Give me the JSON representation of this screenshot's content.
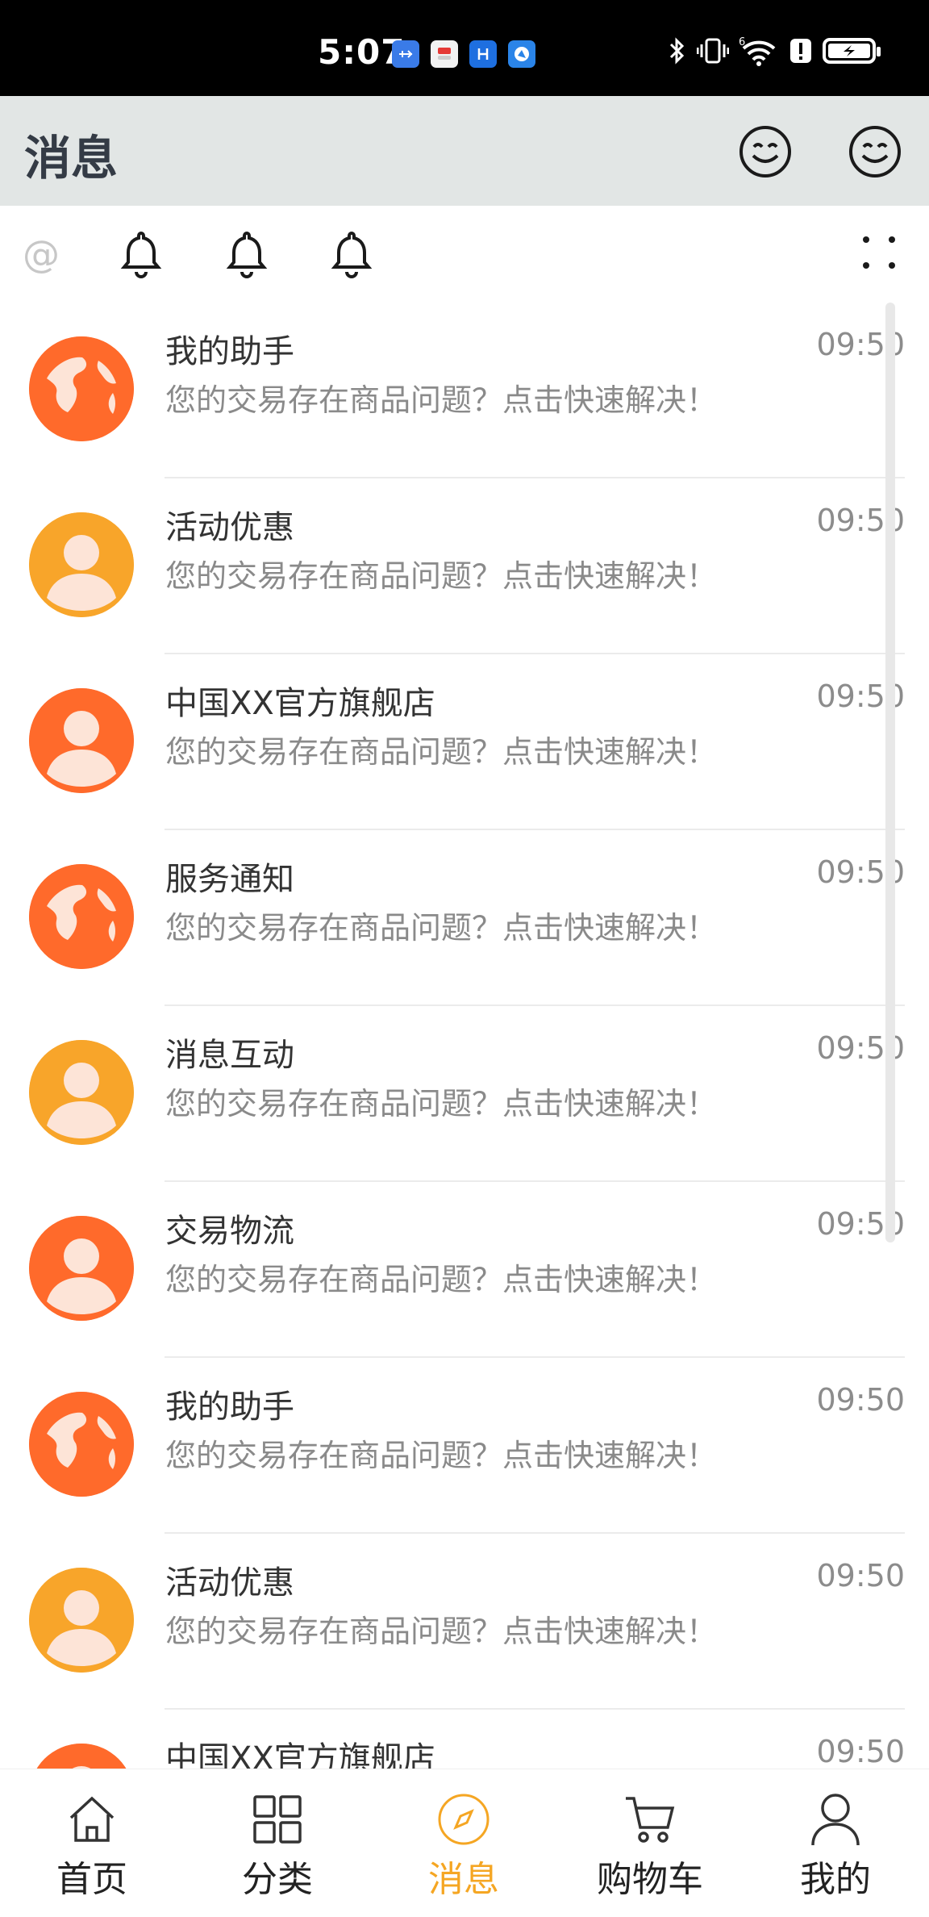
{
  "status_bar": {
    "time": "5:07",
    "notification_icons": [
      "usb-icon",
      "notes-app-icon",
      "app-h-icon",
      "browser-icon"
    ],
    "system_icons": [
      "bluetooth-icon",
      "vibrate-icon",
      "wifi-6-icon",
      "alert-icon",
      "battery-charging-icon"
    ]
  },
  "header": {
    "title": "消息",
    "right_icons": [
      "smiley-icon",
      "smiley-icon"
    ]
  },
  "tabs": {
    "items": [
      "at-icon",
      "bell-icon",
      "bell-icon",
      "bell-icon"
    ],
    "more_icon": "more-dots-icon"
  },
  "colors": {
    "accent": "#f5a623",
    "avatar_orange": "#ff6a2b",
    "avatar_amber": "#f8a52a",
    "header_bg": "#e2e6e5"
  },
  "messages": [
    {
      "title": "我的助手",
      "preview": "您的交易存在商品问题？点击快速解决！",
      "time": "09:50",
      "avatar": "globe",
      "color": "#ff6a2b"
    },
    {
      "title": "活动优惠",
      "preview": "您的交易存在商品问题？点击快速解决！",
      "time": "09:50",
      "avatar": "person",
      "color": "#f8a52a"
    },
    {
      "title": "中国XX官方旗舰店",
      "preview": "您的交易存在商品问题？点击快速解决！",
      "time": "09:50",
      "avatar": "person",
      "color": "#ff6a2b"
    },
    {
      "title": "服务通知",
      "preview": "您的交易存在商品问题？点击快速解决！",
      "time": "09:50",
      "avatar": "globe",
      "color": "#ff6a2b"
    },
    {
      "title": "消息互动",
      "preview": "您的交易存在商品问题？点击快速解决！",
      "time": "09:50",
      "avatar": "person",
      "color": "#f8a52a"
    },
    {
      "title": "交易物流",
      "preview": "您的交易存在商品问题？点击快速解决！",
      "time": "09:50",
      "avatar": "person",
      "color": "#ff6a2b"
    },
    {
      "title": "我的助手",
      "preview": "您的交易存在商品问题？点击快速解决！",
      "time": "09:50",
      "avatar": "globe",
      "color": "#ff6a2b"
    },
    {
      "title": "活动优惠",
      "preview": "您的交易存在商品问题？点击快速解决！",
      "time": "09:50",
      "avatar": "person",
      "color": "#f8a52a"
    },
    {
      "title": "中国XX官方旗舰店",
      "preview": "",
      "time": "09:50",
      "avatar": "person",
      "color": "#ff6a2b"
    }
  ],
  "bottom_nav": [
    {
      "label": "首页",
      "icon": "home-icon",
      "active": false
    },
    {
      "label": "分类",
      "icon": "grid-icon",
      "active": false
    },
    {
      "label": "消息",
      "icon": "compass-icon",
      "active": true
    },
    {
      "label": "购物车",
      "icon": "cart-icon",
      "active": false
    },
    {
      "label": "我的",
      "icon": "person-icon",
      "active": false
    }
  ]
}
